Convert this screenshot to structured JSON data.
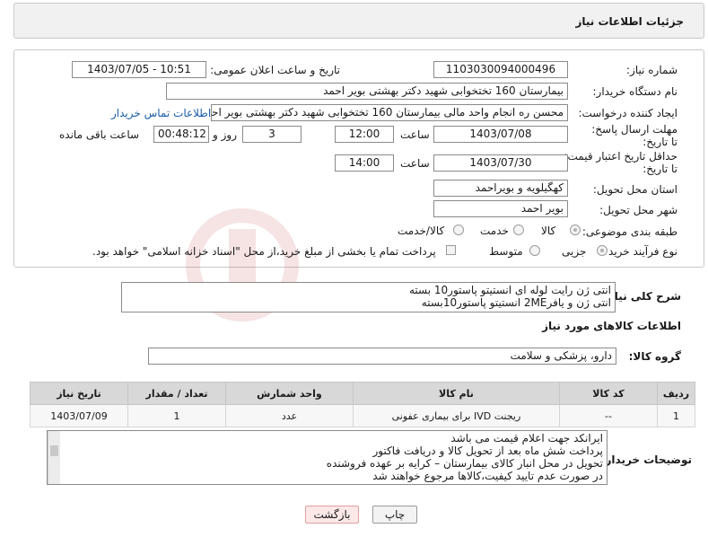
{
  "page": {
    "title": "جزئیات اطلاعات نیاز"
  },
  "labels": {
    "need_number": "شماره نیاز:",
    "announce_datetime": "تاریخ و ساعت اعلان عمومی:",
    "buyer_org": "نام دستگاه خریدار:",
    "requester": "ایجاد کننده درخواست:",
    "contact_link": "اطلاعات تماس خریدار",
    "deadline_send": "مهلت ارسال پاسخ: تا تاریخ:",
    "time_word": "ساعت",
    "day_and": "روز و",
    "hours_remaining": "ساعت باقی مانده",
    "price_validity": "حداقل تاریخ اعتبار قیمت: تا تاریخ:",
    "province": "استان محل تحویل:",
    "city": "شهر محل تحویل:",
    "category": "طبقه بندی موضوعی:",
    "process_type": "نوع فرآیند خرید :",
    "general_desc": "شرح کلی نیاز:",
    "goods_info": "اطلاعات کالاهای مورد نیاز",
    "goods_group": "گروه کالا:",
    "buyer_notes": "توضیحات خریدار:"
  },
  "fields": {
    "need_number": "1103030094000496",
    "announce_datetime": "1403/07/05 - 10:51",
    "buyer_org": "بیمارستان 160 تختخوابی شهید دکتر بهشتی بویر احمد",
    "requester": "محسن ره انجام واحد مالی بیمارستان 160 تختخوابی شهید دکتر بهشتی بویر احمد",
    "deadline_date": "1403/07/08",
    "deadline_time": "12:00",
    "days_left": "3",
    "time_left": "00:48:12",
    "validity_date": "1403/07/30",
    "validity_time": "14:00",
    "province": "کهگیلویه و بویراحمد",
    "city": "بویر احمد",
    "goods_group": "دارو، پزشکی و سلامت"
  },
  "category_options": [
    {
      "label": "کالا",
      "selected": true
    },
    {
      "label": "خدمت",
      "selected": false
    },
    {
      "label": "کالا/خدمت",
      "selected": false
    }
  ],
  "process_options": [
    {
      "label": "جزیی",
      "selected": true
    },
    {
      "label": "متوسط",
      "selected": false
    }
  ],
  "payment_note": "پرداخت تمام یا بخشی از مبلغ خرید،از محل \"اسناد خزانه اسلامی\" خواهد بود.",
  "general_desc": {
    "line1": "انتی ژن رایت لوله ای انستیتو پاستور10 بسته",
    "line2": "انتی ژن و یافر2ME انستیتو پاستور10بسته"
  },
  "table": {
    "headers": [
      "ردیف",
      "کد کالا",
      "نام کالا",
      "واحد شمارش",
      "تعداد / مقدار",
      "تاریخ نیاز"
    ],
    "rows": [
      [
        "1",
        "--",
        "ریجنت IVD برای بیماری عفونی",
        "عدد",
        "1",
        "1403/07/09"
      ]
    ]
  },
  "buyer_notes": {
    "line1": "ایرانکد جهت اعلام قیمت می باشد",
    "line2": "پرداخت شش ماه بعد از تحویل کالا و دریافت فاکتور",
    "line3": "تحویل در محل انبار کالای بیمارستان – کرایه بر عهده فروشنده",
    "line4": "در صورت عدم تایید کیفیت،کالاها مرجوع خواهند شد"
  },
  "buttons": {
    "print": "چاپ",
    "back": "بازگشت"
  },
  "watermark": "AriaTender.neT",
  "colors": {
    "link": "#1b5ea8",
    "header_bg": "#f1f1f1",
    "table_header": "#d8d8d8",
    "back_button": "#fde8e8"
  }
}
